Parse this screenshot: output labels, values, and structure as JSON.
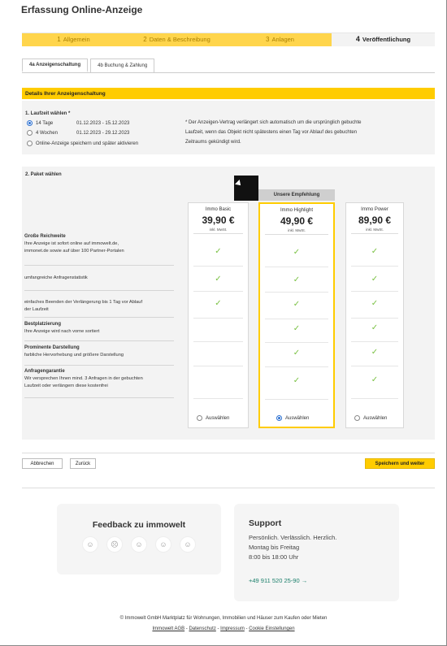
{
  "page_title": "Erfassung Online-Anzeige",
  "steps": [
    {
      "num": "1",
      "label": "Allgemein"
    },
    {
      "num": "2",
      "label": "Daten & Beschreibung"
    },
    {
      "num": "3",
      "label": "Anlagen"
    },
    {
      "num": "4",
      "label": "Veröffentlichung"
    }
  ],
  "tabs": [
    {
      "label": "4a Anzeigenschaltung"
    },
    {
      "label": "4b Buchung & Zahlung"
    }
  ],
  "details_header": "Details Ihrer Anzeigenschaltung",
  "runtime": {
    "label": "1. Laufzeit wählen *",
    "options": [
      {
        "name": "14 Tage",
        "dates": "01.12.2023 - 15.12.2023",
        "selected": true
      },
      {
        "name": "4 Wochen",
        "dates": "01.12.2023 - 29.12.2023",
        "selected": false
      },
      {
        "name": "Online-Anzeige speichern und später aktivieren",
        "dates": "",
        "selected": false
      }
    ],
    "note_lines": [
      "* Der Anzeigen-Vertrag verlängert sich automatisch um die ursprünglich gebuchte",
      "Laufzeit, wenn das Objekt nicht spätestens einen Tag vor Ablauf des gebuchten",
      "Zeitraums gekündigt wird."
    ]
  },
  "package": {
    "label": "2. Paket wählen",
    "recommendation": "Unsere Empfehlung",
    "features": [
      {
        "title": "Große Reichweite",
        "lines": [
          "Ihre Anzeige ist sofort online auf immowelt.de,",
          "immonet.de sowie auf über 100 Partner-Portalen"
        ]
      },
      {
        "title": "",
        "lines": [
          "umfangreiche Anfragenstatistik"
        ]
      },
      {
        "title": "",
        "lines": [
          "einfaches Beenden der Verlängerung bis 1 Tag vor Ablauf",
          "der Laufzeit"
        ]
      },
      {
        "title": "Bestplatzierung",
        "lines": [
          "Ihre Anzeige wird nach vorne sortiert"
        ]
      },
      {
        "title": "Prominente Darstellung",
        "lines": [
          "farbliche Hervorhebung und größere Darstellung"
        ]
      },
      {
        "title": "Anfragengarantie",
        "lines": [
          "Wir versprechen Ihnen mind. 3 Anfragen in der gebuchten",
          "Laufzeit oder verlängern diese kostenfrei"
        ]
      }
    ],
    "plans": [
      {
        "name": "Immo Basic",
        "price": "39,90 €",
        "vat": "inkl. MwSt.",
        "checks": [
          true,
          true,
          true,
          false,
          false,
          false
        ],
        "select_label": "Auswählen",
        "selected": false
      },
      {
        "name": "Immo Highlight",
        "price": "49,90 €",
        "vat": "inkl. MwSt.",
        "checks": [
          true,
          true,
          true,
          true,
          true,
          true
        ],
        "select_label": "Auswählen",
        "selected": true
      },
      {
        "name": "Immo Power",
        "price": "89,90 €",
        "vat": "inkl. MwSt.",
        "checks": [
          true,
          true,
          true,
          true,
          true,
          true
        ],
        "select_label": "Auswählen",
        "selected": false
      }
    ],
    "check_glyph": "✓"
  },
  "actions": {
    "cancel": "Abbrechen",
    "back": "Zurück",
    "save_continue": "Speichern und weiter"
  },
  "feedback": {
    "title": "Feedback zu immowelt",
    "smileys": [
      "☺",
      "☹",
      "☺",
      "☺",
      "☺"
    ]
  },
  "support": {
    "title": "Support",
    "lines": [
      "Persönlich. Verlässlich. Herzlich.",
      "Montag bis Freitag",
      "8:00 bis 18:00 Uhr"
    ],
    "phone": "+49 911 520 25-90 →"
  },
  "footer": {
    "copyright": "© Immowelt GmbH Marktplatz für Wohnungen, Immobilien und Häuser zum Kaufen oder Mieten",
    "links": [
      "Immowelt AGB",
      "Datenschutz",
      "Impressum",
      "Cookie Einstellungen"
    ],
    "separator": " - "
  },
  "colors": {
    "accent": "#ffcc00",
    "check": "#7ac143",
    "link": "#1a7f6a"
  }
}
